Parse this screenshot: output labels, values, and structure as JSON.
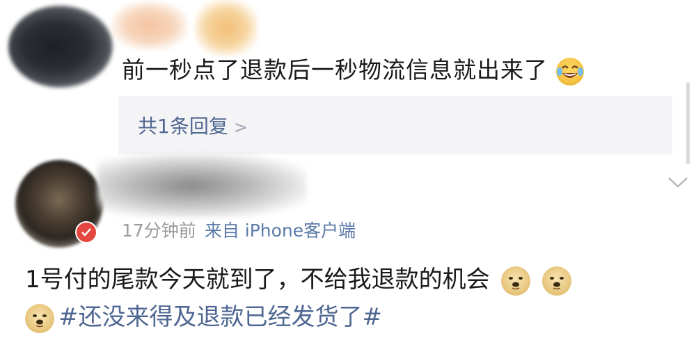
{
  "comments": [
    {
      "text": "前一秒点了退款后一秒物流信息就出来了",
      "emoji": "laughing-crying-icon",
      "reply_summary": {
        "label": "共1条回复",
        "chevron": ">"
      }
    },
    {
      "meta": {
        "time": "17分钟前",
        "client": "来自 iPhone客户端"
      },
      "badge_icon": "verified-badge-icon",
      "text_line1": "1号付的尾款今天就到了，不给我退款的机会",
      "hashtag": "#还没来得及退款已经发货了#",
      "emoji": "doge-icon"
    }
  ],
  "colors": {
    "text": "#1a1a1a",
    "link": "#4e6691",
    "meta": "#9a9a9a",
    "reply_bg": "#f4f4f6"
  }
}
